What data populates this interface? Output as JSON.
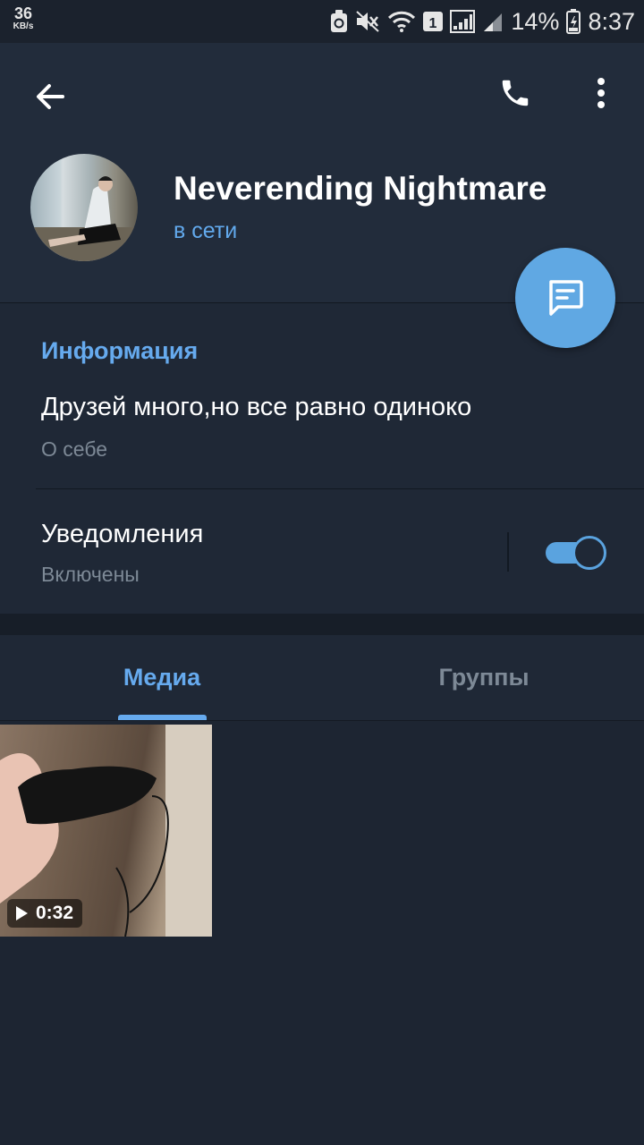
{
  "status_bar": {
    "speed_value": "36",
    "speed_unit": "KB/s",
    "sim_slot": "1",
    "battery": "14%",
    "time": "8:37",
    "icons": [
      "sync-icon",
      "mute-icon",
      "wifi-icon",
      "sim-1-icon",
      "signal-icon",
      "signal-icon",
      "battery-icon"
    ]
  },
  "header": {
    "icons": [
      "back-arrow-icon",
      "phone-icon",
      "more-vertical-icon"
    ],
    "name": "Neverending Nightmare",
    "status": "в сети",
    "accent_color": "#62a9ec"
  },
  "fab": {
    "icon": "message-icon",
    "color": "#60a8e3"
  },
  "info": {
    "title": "Информация",
    "bio": "Друзей много,но все равно одиноко",
    "bio_label": "О себе",
    "notifications_title": "Уведомления",
    "notifications_status": "Включены",
    "notifications_enabled": true
  },
  "tabs": [
    {
      "label": "Медиа",
      "active": true
    },
    {
      "label": "Группы",
      "active": false
    }
  ],
  "media": [
    {
      "type": "video",
      "duration": "0:32",
      "icon": "play-icon"
    }
  ]
}
